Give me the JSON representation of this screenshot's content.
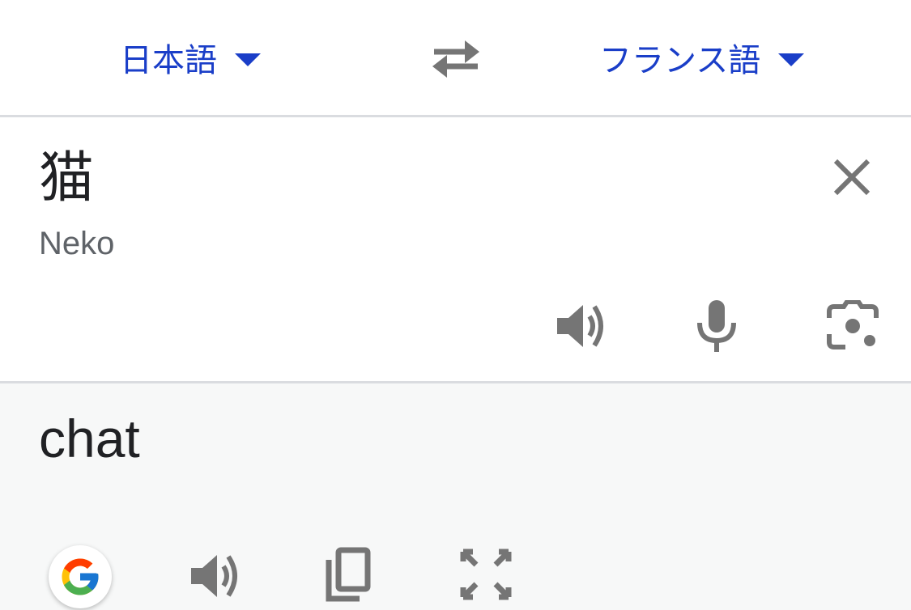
{
  "languages": {
    "source": "日本語",
    "target": "フランス語"
  },
  "source": {
    "text": "猫",
    "romanization": "Neko"
  },
  "result": {
    "text": "chat"
  },
  "icons": {
    "swap": "swap-arrows-icon",
    "clear": "close-icon",
    "listen_source": "speaker-icon",
    "voice_input": "microphone-icon",
    "camera": "camera-lens-icon",
    "google": "google-g-icon",
    "listen_result": "speaker-icon",
    "copy": "copy-icon",
    "fullscreen": "fullscreen-icon"
  },
  "colors": {
    "accent": "#1a3ec8",
    "icon_gray": "#757575",
    "divider": "#dadce0",
    "result_bg": "#f7f8f8"
  }
}
